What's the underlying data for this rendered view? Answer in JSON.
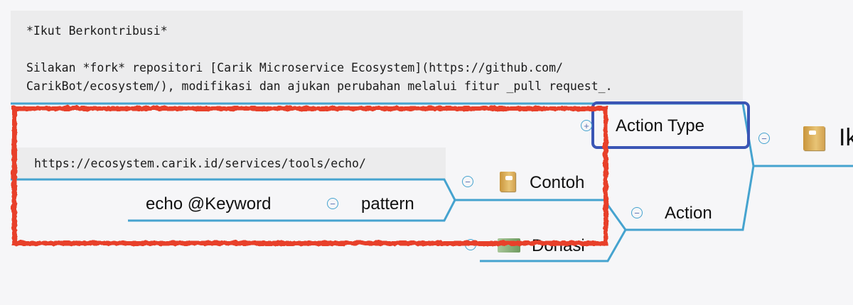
{
  "note_top": {
    "line1": "*Ikut Berkontribusi*",
    "line2": "Silakan *fork* repositori [Carik Microservice Ecosystem](https://github.com/",
    "line3": "CarikBot/ecosystem/), modifikasi dan ajukan perubahan melalui fitur _pull request_."
  },
  "nodes": {
    "root": "Ik",
    "action_type": "Action Type",
    "action": "Action",
    "contoh": "Contoh",
    "donasi": "Donasi",
    "pattern": "pattern",
    "echo_keyword": "echo @Keyword",
    "url_note": "https://ecosystem.carik.id/services/tools/echo/"
  },
  "colors": {
    "branch": "#45a3cf",
    "selection": "#3a55b5",
    "annotation": "#e8402a"
  }
}
